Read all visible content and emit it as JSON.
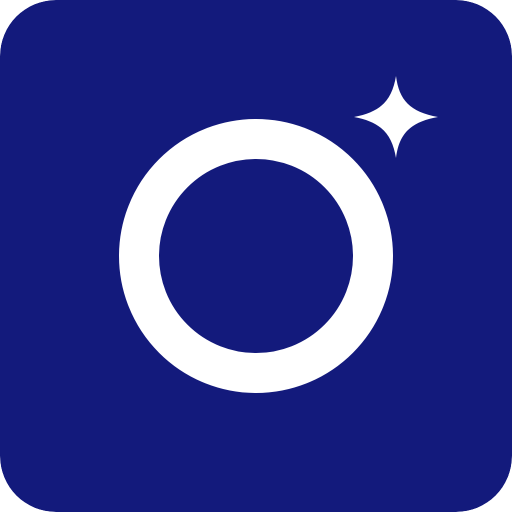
{
  "icon": {
    "name": "camera-lens-sparkle-app-icon",
    "background_color": "#131a7c",
    "foreground_color": "#ffffff",
    "glyphs": [
      "ring-icon",
      "sparkle-icon"
    ]
  }
}
